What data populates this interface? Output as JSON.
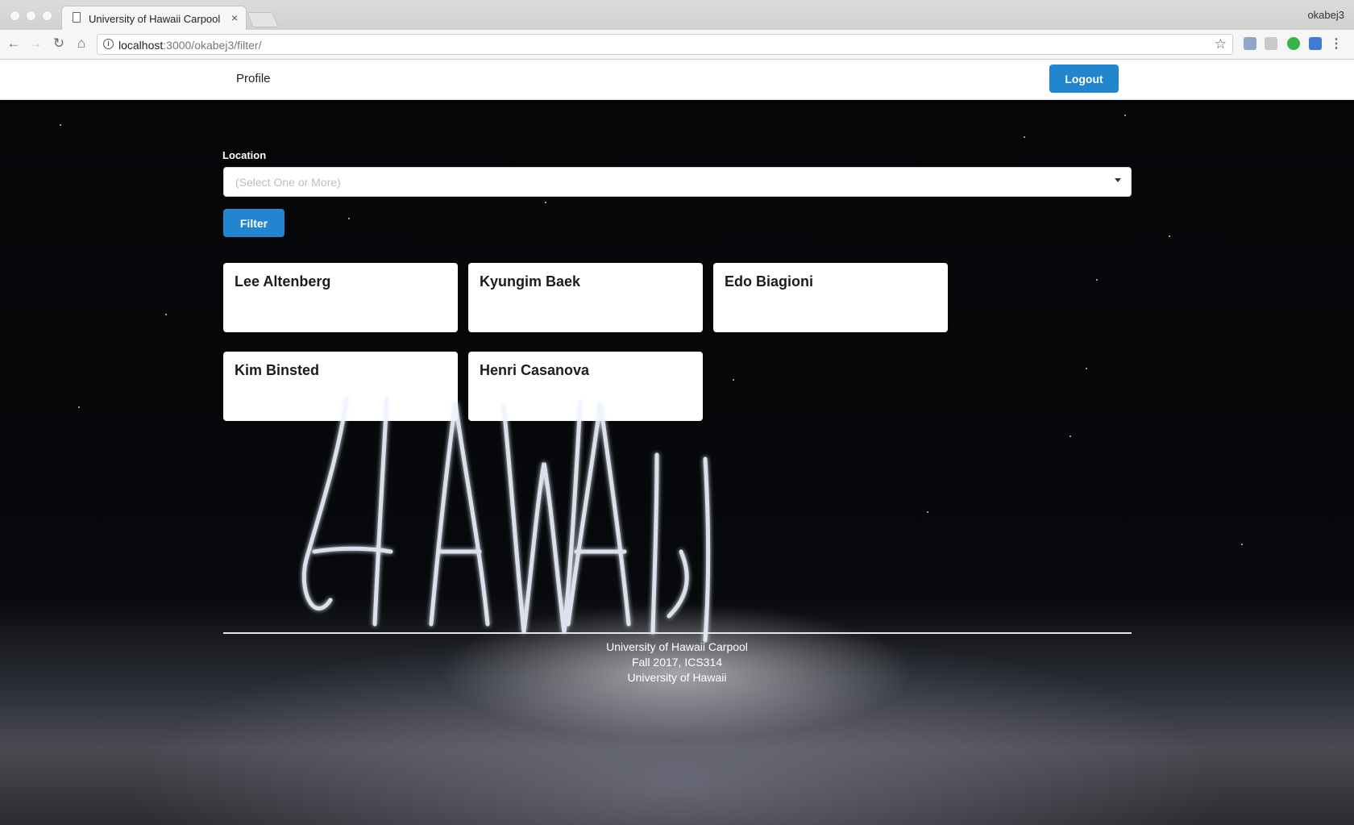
{
  "browser": {
    "tab_title": "University of Hawaii Carpool",
    "tab_close": "×",
    "profile_name": "okabej3",
    "url_host": "localhost",
    "url_rest": ":3000/okabej3/filter/",
    "info_glyph": "i",
    "star_glyph": "☆",
    "menu_glyph": "⋮",
    "back_glyph": "←",
    "forward_glyph": "→",
    "reload_glyph": "↻",
    "home_glyph": "⌂"
  },
  "navbar": {
    "profile_label": "Profile",
    "logout_label": "Logout"
  },
  "filter": {
    "location_label": "Location",
    "placeholder": "(Select One or More)",
    "button_label": "Filter"
  },
  "cards": [
    {
      "name": "Lee Altenberg"
    },
    {
      "name": "Kyungim Baek"
    },
    {
      "name": "Edo Biagioni"
    },
    {
      "name": "Kim Binsted"
    },
    {
      "name": "Henri Casanova"
    }
  ],
  "footer": {
    "line1": "University of Hawaii Carpool",
    "line2": "Fall 2017, ICS314",
    "line3": "University of Hawaii"
  },
  "colors": {
    "primary": "#2185d0",
    "background": "#050608"
  },
  "icons": [
    "page-icon",
    "info-icon",
    "star-icon",
    "menu-icon",
    "back-icon",
    "forward-icon",
    "reload-icon",
    "home-icon",
    "chevron-down-icon"
  ]
}
